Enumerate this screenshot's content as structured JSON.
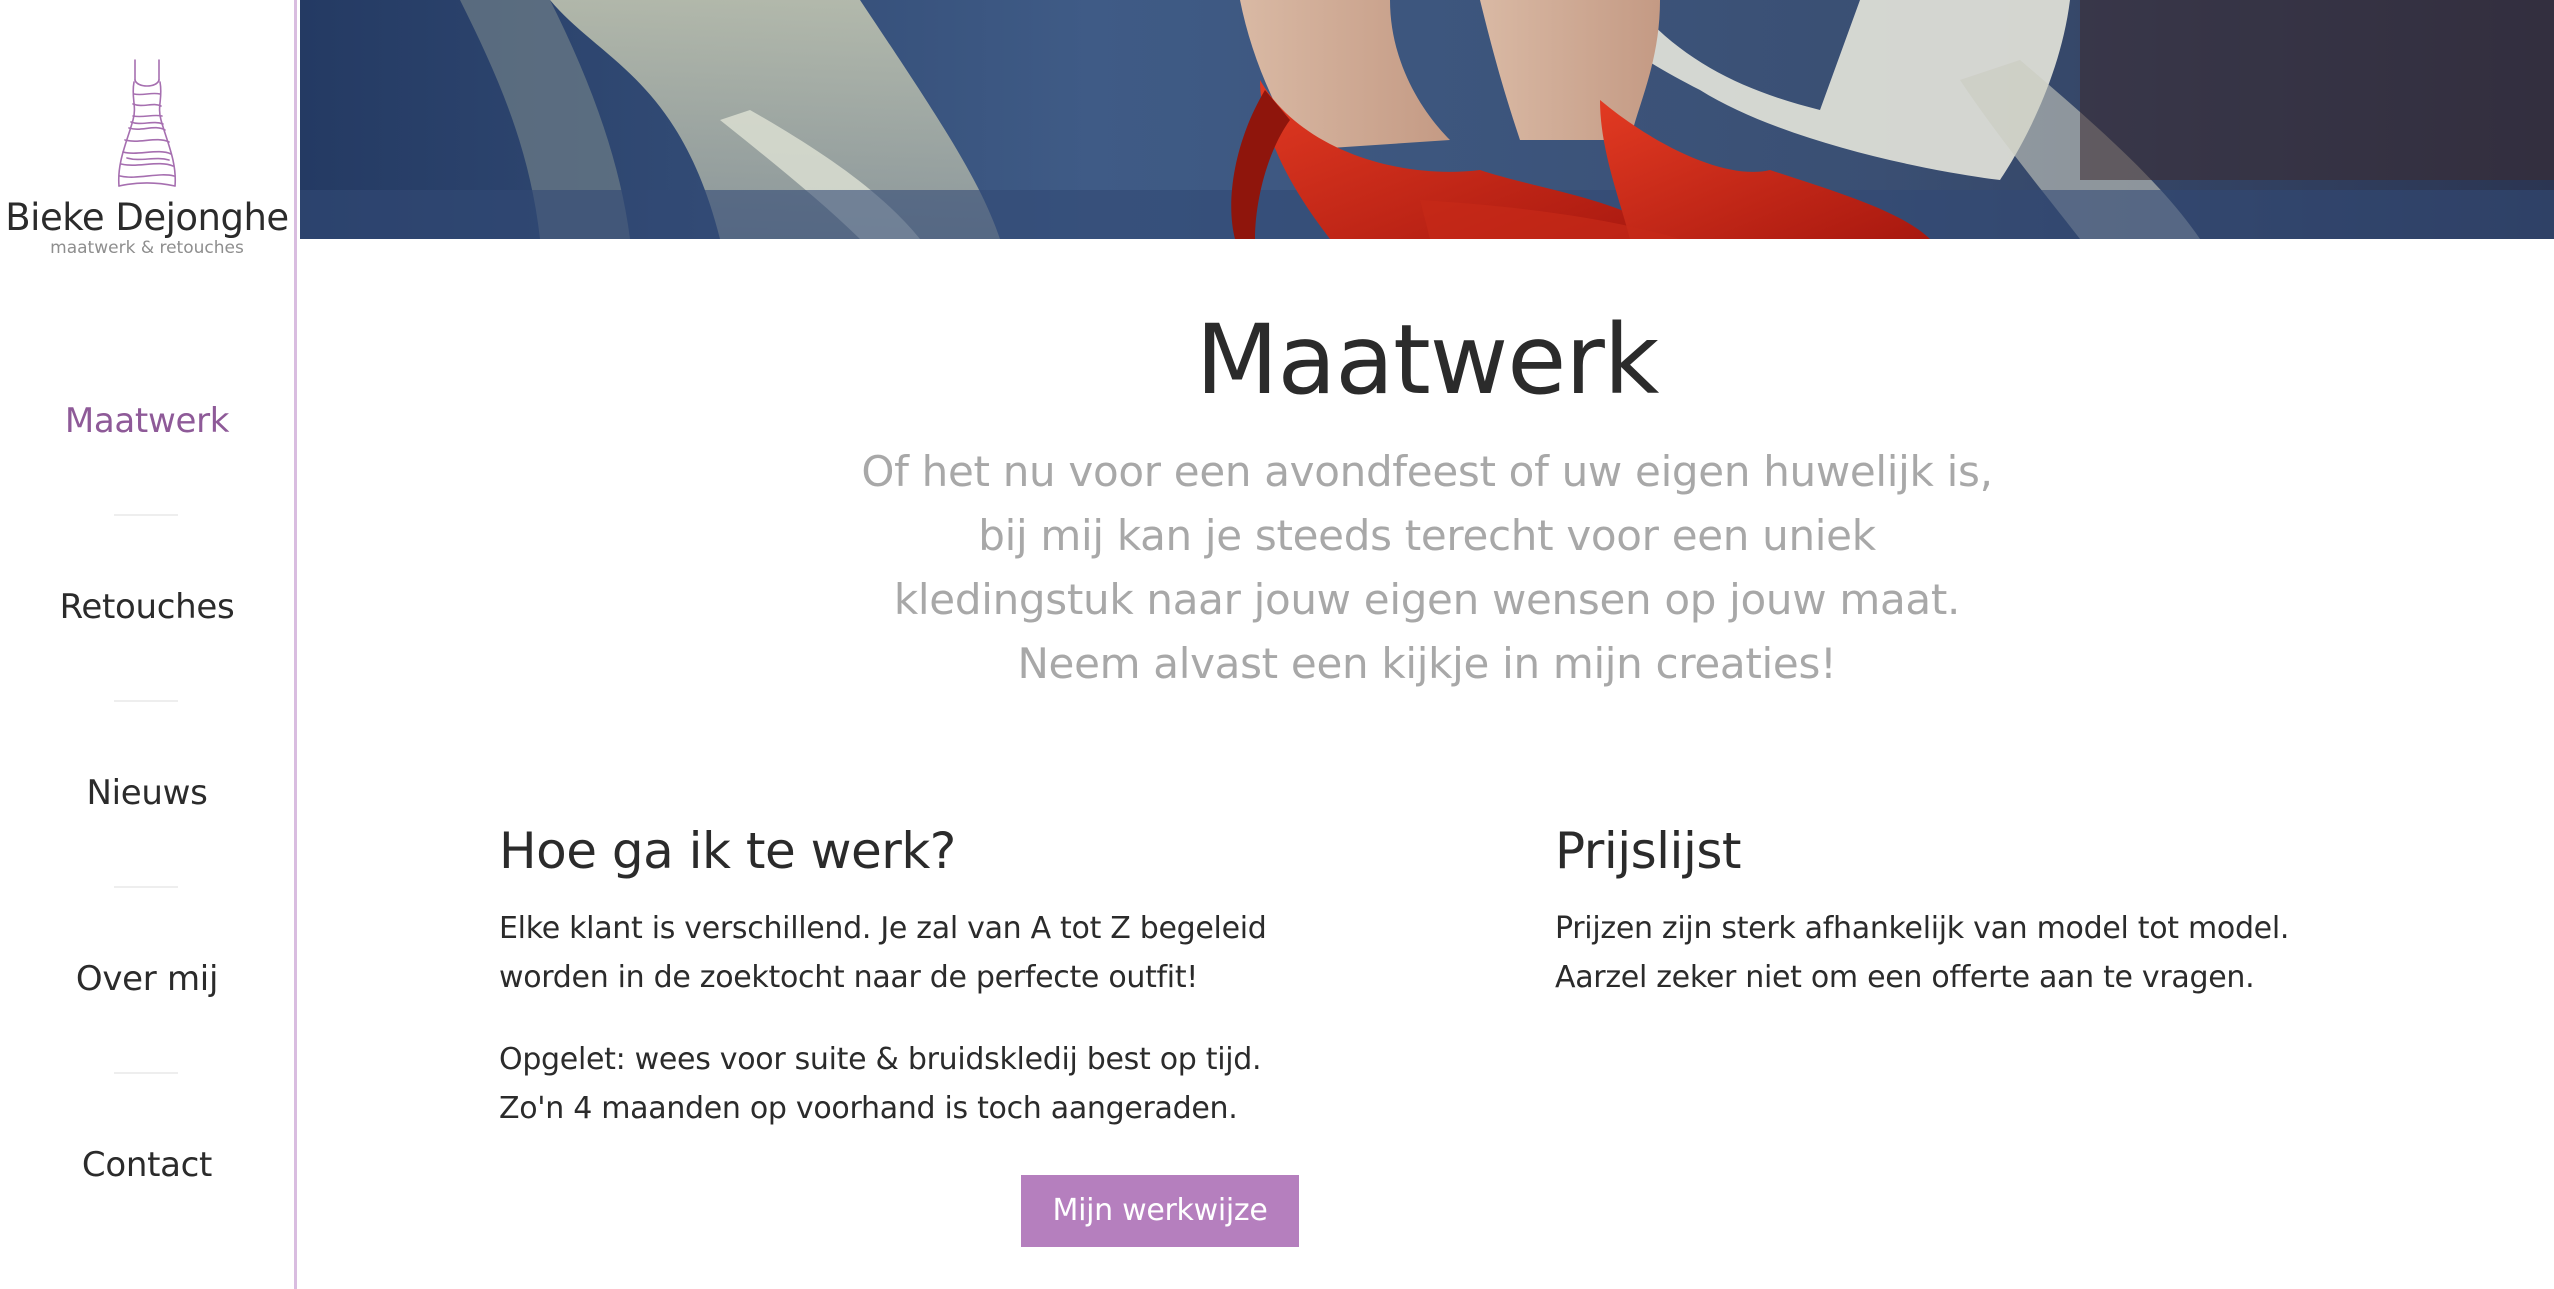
{
  "brand": {
    "name": "Bieke Dejonghe",
    "tagline": "maatwerk & retouches",
    "logo_icon": "dress-icon",
    "accent_color": "#b57fbe",
    "active_color": "#8e5a98"
  },
  "nav": {
    "items": [
      {
        "label": "Maatwerk",
        "active": true
      },
      {
        "label": "Retouches",
        "active": false
      },
      {
        "label": "Nieuws",
        "active": false
      },
      {
        "label": "Over mij",
        "active": false
      },
      {
        "label": "Contact",
        "active": false
      }
    ]
  },
  "main": {
    "title": "Maatwerk",
    "intro": "Of het nu voor een avondfeest of uw eigen huwelijk is, bij mij kan je steeds terecht voor een uniek kledingstuk naar jouw eigen wensen op jouw maat. Neem alvast een kijkje in mijn creaties!",
    "left": {
      "heading": "Hoe ga ik te werk?",
      "paragraph1": "Elke klant is verschillend. Je zal van A tot Z begeleid worden in de zoektocht naar de perfecte outfit!",
      "paragraph2": "Opgelet: wees voor suite & bruidskledij best op tijd. Zo'n 4 maanden op voorhand is toch aangeraden.",
      "button_label": "Mijn werkwijze"
    },
    "right": {
      "heading": "Prijslijst",
      "paragraph1": "Prijzen zijn sterk afhankelijk van model tot model. Aarzel zeker niet om een offerte aan te vragen."
    }
  }
}
